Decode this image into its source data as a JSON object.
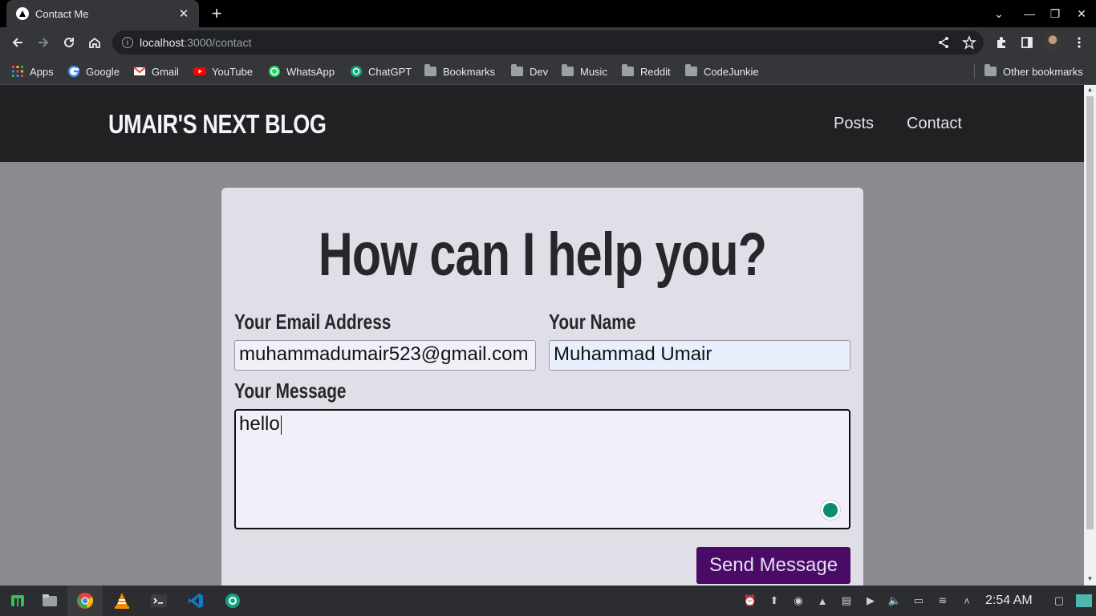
{
  "browser": {
    "tab_title": "Contact Me",
    "url_host": "localhost",
    "url_path": ":3000/contact",
    "bookmarks": [
      {
        "label": "Apps"
      },
      {
        "label": "Google"
      },
      {
        "label": "Gmail"
      },
      {
        "label": "YouTube"
      },
      {
        "label": "WhatsApp"
      },
      {
        "label": "ChatGPT"
      },
      {
        "label": "Bookmarks"
      },
      {
        "label": "Dev"
      },
      {
        "label": "Music"
      },
      {
        "label": "Reddit"
      },
      {
        "label": "CodeJunkie"
      }
    ],
    "other_bookmarks": "Other bookmarks"
  },
  "site": {
    "logo": "UMAIR'S NEXT BLOG",
    "nav": [
      "Posts",
      "Contact"
    ]
  },
  "form": {
    "heading": "How can I help you?",
    "email_label": "Your Email Address",
    "email_value": "muhammadumair523@gmail.com",
    "name_label": "Your Name",
    "name_value": "Muhammad Umair",
    "message_label": "Your Message",
    "message_value": "hello",
    "submit_label": "Send Message"
  },
  "taskbar": {
    "clock": "2:54 AM"
  },
  "colors": {
    "header_bg": "#212023",
    "page_bg": "#8b8a91",
    "card_bg": "#e0dee6",
    "button_bg": "#4a0b66"
  }
}
